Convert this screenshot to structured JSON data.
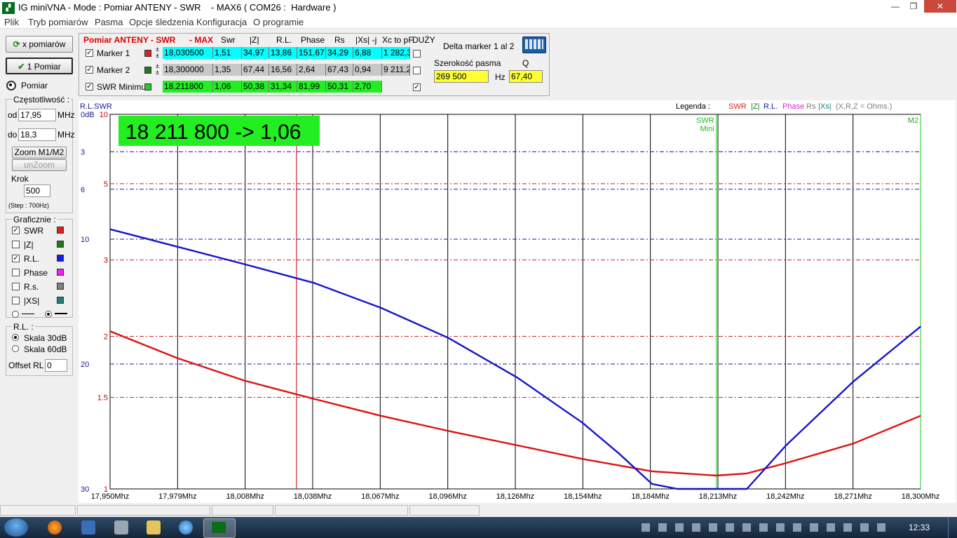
{
  "window": {
    "title": "IG miniVNA - Mode : Pomiar ANTENY - SWR    - MAX6 ( COM26 :  Hardware )",
    "icon": "vna-app-icon",
    "controls": [
      "—",
      "❐",
      "✕"
    ]
  },
  "menu": [
    "Plik",
    "Tryb pomiarów",
    "Pasma",
    "Opcje śledzenia",
    "Konfiguracja",
    "O programie"
  ],
  "left": {
    "btn_x_pomiarow": "x pomiarów",
    "btn_1_pomiar": "1 Pomiar",
    "pomiar_label": "Pomiar",
    "freq_group": "Częstotliwość :",
    "od_label": "od",
    "od_value": "17,95",
    "od_unit": "MHz",
    "do_label": "do",
    "do_value": "18,3",
    "do_unit": "MHz",
    "zoom_btn": "Zoom M1/M2",
    "unzoom_btn": "unZoom",
    "krok_label": "Krok",
    "krok_value": "500",
    "step_note": "(Step : 700Hz)",
    "graf_group": "Graficznie :",
    "graf_items": [
      {
        "label": "SWR",
        "checked": true,
        "color": "#e02020"
      },
      {
        "label": "|Z|",
        "checked": false,
        "color": "#1f7a1f"
      },
      {
        "label": "R.L.",
        "checked": true,
        "color": "#1a1aee"
      },
      {
        "label": "Phase",
        "checked": false,
        "color": "#ee22ee"
      },
      {
        "label": "R.s.",
        "checked": false,
        "color": "#808080"
      },
      {
        "label": "|XS|",
        "checked": false,
        "color": "#207f7f"
      }
    ],
    "rl_group": "R.L. :",
    "skala30": "Skala 30dB",
    "skala60": "Skala 60dB",
    "offset_label": "Offset RL",
    "offset_value": "0"
  },
  "mtable": {
    "header": {
      "title": "Pomiar ANTENY - SWR",
      "max": "- MAX",
      "cols": [
        "Swr",
        "|Z|",
        "R.L.",
        "Phase",
        "Rs",
        "|Xs| -j",
        "Xc to pF",
        "DUŻY"
      ]
    },
    "rows": [
      {
        "name": "Marker 1",
        "color": "#e02020",
        "freq": "18,030500",
        "vals": [
          "1,51",
          "34,97",
          "13,86",
          "151,67",
          "34,29",
          "6,88",
          "1 282,3"
        ],
        "bg": "#00ffff",
        "duzy": false
      },
      {
        "name": "Marker 2",
        "color": "#1f7a1f",
        "freq": "18,300000",
        "vals": [
          "1,35",
          "67,44",
          "16,56",
          "2,64",
          "67,43",
          "0,94",
          "9 211,2"
        ],
        "bg": "#c8c8c8",
        "duzy": false
      },
      {
        "name": "SWR Minimu",
        "color": "#22cc22",
        "freq": "18,211800",
        "vals": [
          "1,06",
          "50,38",
          "31,34",
          "81,99",
          "50,31",
          "2,70"
        ],
        "bg": "#22ee22",
        "duzy": true
      }
    ],
    "delta_label": "Delta marker 1 al 2",
    "bw_label": "Szerokość pasma",
    "q_label": "Q",
    "bw_value": "269 500",
    "hz": "Hz",
    "q_value": "67,40"
  },
  "chart_data": {
    "type": "line",
    "banner": "18 211 800 -> 1,06",
    "corner_label": "R.L.SWR",
    "legend_title": "Legenda :",
    "legend_items": [
      {
        "label": "SWR",
        "color": "#dd2222"
      },
      {
        "label": "|Z|",
        "color": "#1f7a1f"
      },
      {
        "label": "R.L.",
        "color": "#1a1aaa"
      },
      {
        "label": "Phase",
        "color": "#dd22dd"
      },
      {
        "label": "Rs",
        "color": "#808080"
      },
      {
        "label": "|Xs|",
        "color": "#207f7f"
      },
      {
        "label": "(X,R,Z = Ohms.)",
        "color": "#808080"
      }
    ],
    "x_ticks": [
      "17,950Mhz",
      "17,979Mhz",
      "18,008Mhz",
      "18,038Mhz",
      "18,067Mhz",
      "18,096Mhz",
      "18,126Mhz",
      "18,154Mhz",
      "18,184Mhz",
      "18,213Mhz",
      "18,242Mhz",
      "18,271Mhz",
      "18,300Mhz"
    ],
    "xlim": [
      17.95,
      18.3
    ],
    "swr_ticks": [
      {
        "v": 10,
        "label": "10"
      },
      {
        "v": 5,
        "label": "5"
      },
      {
        "v": 3,
        "label": "3"
      },
      {
        "v": 2,
        "label": "2"
      },
      {
        "v": 1.5,
        "label": "1.5"
      },
      {
        "v": 1,
        "label": "1"
      }
    ],
    "rl_ticks": [
      {
        "v": 0,
        "label": "0dB"
      },
      {
        "v": 3,
        "label": "3"
      },
      {
        "v": 6,
        "label": "6"
      },
      {
        "v": 10,
        "label": "10"
      },
      {
        "v": 20,
        "label": "20"
      },
      {
        "v": 30,
        "label": "30"
      }
    ],
    "rl_ylim": [
      0,
      30
    ],
    "swr_ylim": [
      1,
      10
    ],
    "markers": [
      {
        "freq": 18.0305,
        "label": "",
        "color": "#cc0000"
      },
      {
        "freq": 18.2118,
        "label": "SWR Mini",
        "color": "#22cc22"
      },
      {
        "freq": 18.3,
        "label": "M2",
        "color": "#22cc22"
      }
    ],
    "series": [
      {
        "name": "SWR",
        "color": "#dd1111",
        "x": [
          17.95,
          17.979,
          18.008,
          18.038,
          18.067,
          18.096,
          18.126,
          18.154,
          18.184,
          18.2118,
          18.225,
          18.242,
          18.271,
          18.3
        ],
        "y": [
          2.05,
          1.8,
          1.62,
          1.49,
          1.38,
          1.29,
          1.21,
          1.14,
          1.08,
          1.06,
          1.07,
          1.12,
          1.22,
          1.38
        ]
      },
      {
        "name": "R.L.",
        "color": "#1515cc",
        "x": [
          17.95,
          17.979,
          18.008,
          18.038,
          18.067,
          18.096,
          18.126,
          18.154,
          18.17,
          18.184,
          18.195,
          18.225,
          18.242,
          18.271,
          18.3
        ],
        "y": [
          9.2,
          10.6,
          12.0,
          13.5,
          15.5,
          17.9,
          21.1,
          24.7,
          27.2,
          29.6,
          30.0,
          30.0,
          26.5,
          21.4,
          17.0
        ]
      }
    ]
  },
  "statusbar": [
    "",
    "",
    "",
    "",
    ""
  ],
  "taskbar": {
    "time": "12:33",
    "apps": [
      "start-orb",
      "firefox-icon",
      "save-icon",
      "tools-icon",
      "explorer-icon",
      "ie-icon",
      "minivna-icon"
    ]
  }
}
